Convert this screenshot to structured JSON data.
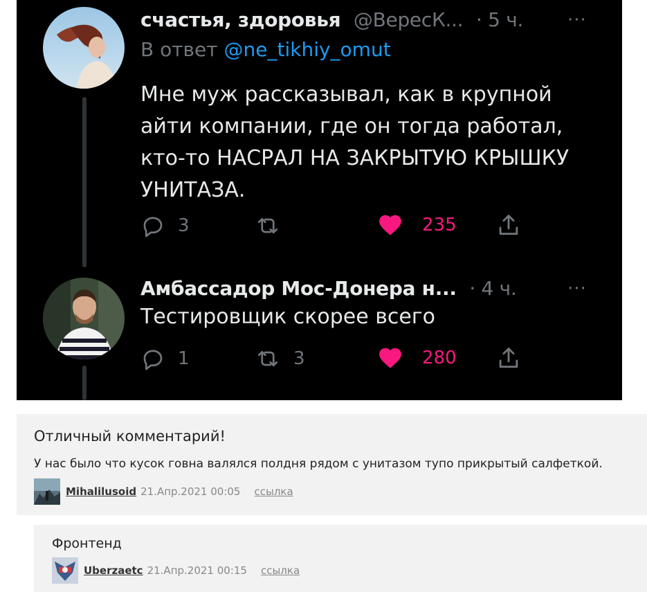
{
  "tweet1": {
    "name": "счастья, здоровья",
    "handle": "@ВересК...",
    "time": "· 5 ч.",
    "more": "···",
    "reply_prefix": "В ответ",
    "reply_mention": "@ne_tikhiy_omut",
    "text": "Мне муж рассказывал, как в крупной айти компании, где он тогда работал, кто-то НАСРАЛ НА ЗАКРЫТУЮ КРЫШКУ УНИТАЗА.",
    "replies": "3",
    "retweets": "",
    "likes": "235"
  },
  "tweet2": {
    "name": "Амбассадор Мос-Донера н...",
    "time": "· 4 ч.",
    "more": "···",
    "text": "Тестировщик скорее всего",
    "replies": "1",
    "retweets": "3",
    "likes": "280"
  },
  "comment1": {
    "title": "Отличный комментарий!",
    "text": "У нас было что кусок говна валялся полдня рядом с унитазом тупо прикрытый салфеткой.",
    "user": "Mihalilusoid",
    "date": "21.Апр.2021 00:05",
    "link": "ссылка"
  },
  "comment2": {
    "title": "Фронтенд",
    "user": "Uberzaetc",
    "date": "21.Апр.2021 00:15",
    "link": "ссылка"
  },
  "colors": {
    "like": "#f91880",
    "mention": "#1d9bf0",
    "muted": "#71767b",
    "comment_bg": "#f2f2f2"
  },
  "icons": [
    "reply-icon",
    "retweet-icon",
    "heart-icon",
    "share-icon",
    "more-icon"
  ]
}
